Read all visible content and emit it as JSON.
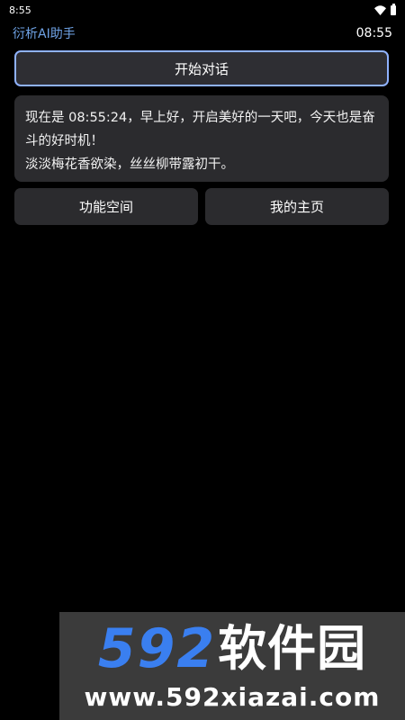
{
  "status_bar": {
    "time": "8:55",
    "icons": [
      "wifi-icon",
      "battery-icon"
    ]
  },
  "header": {
    "title": "衍析AI助手",
    "clock": "08:55"
  },
  "start_chat": {
    "label": "开始对话"
  },
  "greeting": {
    "lines": [
      "现在是 08:55:24，早上好，开启美好的一天吧，今天也是奋斗的好时机！",
      "淡淡梅花香欲染，丝丝柳带露初干。"
    ]
  },
  "actions": {
    "feature_space": "功能空间",
    "my_home": "我的主页"
  },
  "watermark": {
    "digits": "592",
    "name": "软件园",
    "url": "www.592xiazai.com"
  },
  "colors": {
    "background": "#000000",
    "accent_title": "#6fa3e6",
    "button_border": "#8fb2ff",
    "card_background": "#2b2b2e",
    "watermark_blue": "#3a7ff0"
  }
}
